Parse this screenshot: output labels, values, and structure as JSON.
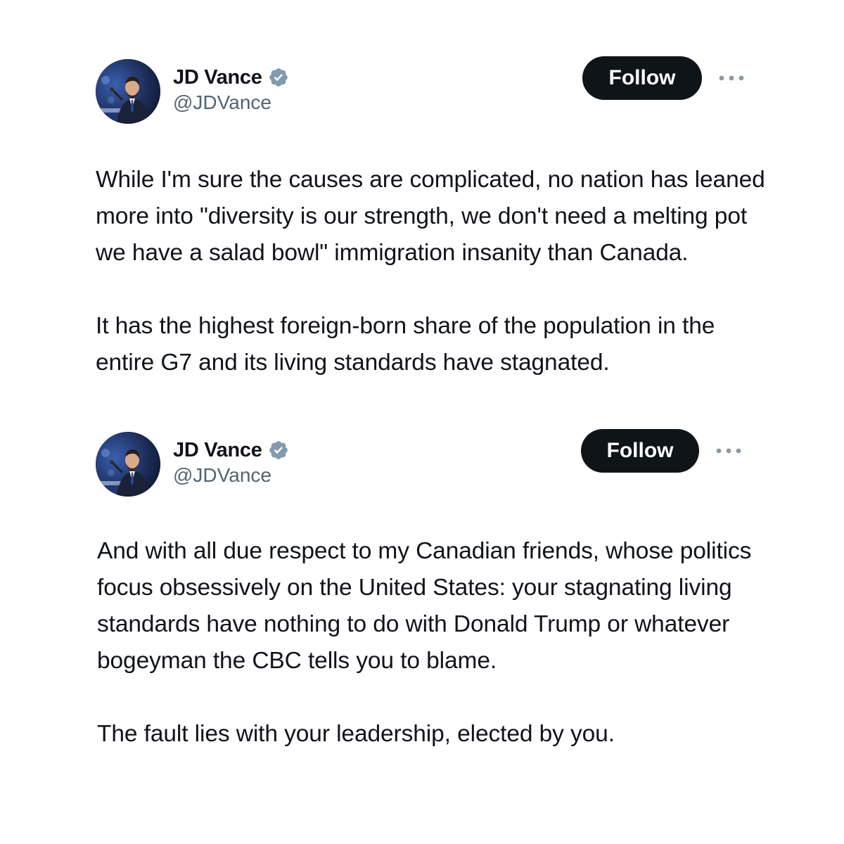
{
  "tweets": [
    {
      "author": {
        "name": "JD Vance",
        "handle": "@JDVance",
        "verified": true
      },
      "follow_label": "Follow",
      "paragraphs": [
        "While I'm sure the causes are complicated, no nation has leaned more into \"diversity is our strength, we don't need a melting pot we have a salad bowl\" immigration insanity than Canada.",
        "It has the highest foreign-born share of the population in the entire G7 and its living standards have stagnated."
      ]
    },
    {
      "author": {
        "name": "JD Vance",
        "handle": "@JDVance",
        "verified": true
      },
      "follow_label": "Follow",
      "paragraphs": [
        "And with all due respect to my Canadian friends, whose politics focus obsessively on the United States: your stagnating living standards have nothing to do with Donald Trump or whatever bogeyman the CBC tells you to blame.",
        "The fault lies with your leadership, elected by you."
      ]
    }
  ],
  "icons": {
    "verified": "verified-badge-icon",
    "more": "more-options-icon"
  },
  "colors": {
    "follow_button_bg": "#0f1419",
    "handle_text": "#536471",
    "verified_badge": "#829aab"
  }
}
